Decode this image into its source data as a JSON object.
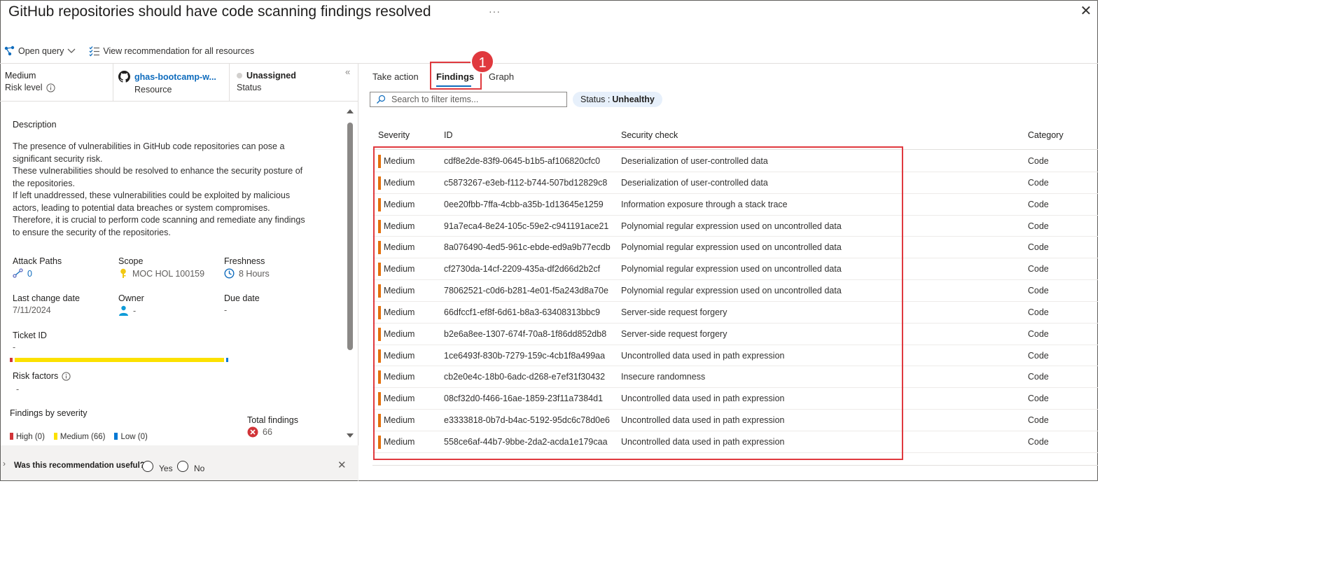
{
  "header": {
    "title": "GitHub repositories should have code scanning findings resolved",
    "more_label": "···",
    "close_label": "✕"
  },
  "toolbar": {
    "open_query_label": "Open query",
    "view_all_label": "View recommendation for all resources"
  },
  "meta": {
    "risk_level_value": "Medium",
    "risk_level_label": "Risk level",
    "resource_value": "ghas-bootcamp-w...",
    "resource_label": "Resource",
    "status_value": "Unassigned",
    "status_label": "Status"
  },
  "details": {
    "description_title": "Description",
    "description_lines": [
      "The presence of vulnerabilities in GitHub code repositories can pose a",
      "significant security risk.",
      "These vulnerabilities should be resolved to enhance the security posture of",
      "the repositories.",
      "If left unaddressed, these vulnerabilities could be exploited by malicious",
      "actors, leading to potential data breaches or system compromises.",
      "Therefore, it is crucial to perform code scanning and remediate any findings",
      "to ensure the security of the repositories."
    ],
    "attack_paths_label": "Attack Paths",
    "attack_paths_value": "0",
    "scope_label": "Scope",
    "scope_value": "MOC HOL 100159",
    "freshness_label": "Freshness",
    "freshness_value": "8 Hours",
    "last_change_label": "Last change date",
    "last_change_value": "7/11/2024",
    "owner_label": "Owner",
    "owner_value": "-",
    "due_date_label": "Due date",
    "due_date_value": "-",
    "ticket_label": "Ticket ID",
    "ticket_value": "-",
    "risk_factors_label": "Risk factors",
    "risk_factors_value": "-",
    "findings_by_severity_label": "Findings by severity",
    "severity_counts": {
      "high": 0,
      "medium": 66,
      "low": 0
    },
    "legend_high": "High (0)",
    "legend_medium": "Medium (66)",
    "legend_low": "Low (0)",
    "total_findings_label": "Total findings",
    "total_findings_value": "66"
  },
  "feedback": {
    "question": "Was this recommendation useful?",
    "yes": "Yes",
    "no": "No"
  },
  "tabs": [
    "Take action",
    "Findings",
    "Graph"
  ],
  "active_tab": "Findings",
  "annotation_number": "1",
  "filter": {
    "placeholder": "Search to filter items...",
    "status_key": "Status :",
    "status_value": "Unhealthy"
  },
  "table": {
    "columns": [
      "Severity",
      "ID",
      "Security check",
      "Category"
    ],
    "rows": [
      [
        "Medium",
        "cdf8e2de-83f9-0645-b1b5-af106820cfc0",
        "Deserialization of user-controlled data",
        "Code"
      ],
      [
        "Medium",
        "c5873267-e3eb-f112-b744-507bd12829c8",
        "Deserialization of user-controlled data",
        "Code"
      ],
      [
        "Medium",
        "0ee20fbb-7ffa-4cbb-a35b-1d13645e1259",
        "Information exposure through a stack trace",
        "Code"
      ],
      [
        "Medium",
        "91a7eca4-8e24-105c-59e2-c941191ace21",
        "Polynomial regular expression used on uncontrolled data",
        "Code"
      ],
      [
        "Medium",
        "8a076490-4ed5-961c-ebde-ed9a9b77ecdb",
        "Polynomial regular expression used on uncontrolled data",
        "Code"
      ],
      [
        "Medium",
        "cf2730da-14cf-2209-435a-df2d66d2b2cf",
        "Polynomial regular expression used on uncontrolled data",
        "Code"
      ],
      [
        "Medium",
        "78062521-c0d6-b281-4e01-f5a243d8a70e",
        "Polynomial regular expression used on uncontrolled data",
        "Code"
      ],
      [
        "Medium",
        "66dfccf1-ef8f-6d61-b8a3-63408313bbc9",
        "Server-side request forgery",
        "Code"
      ],
      [
        "Medium",
        "b2e6a8ee-1307-674f-70a8-1f86dd852db8",
        "Server-side request forgery",
        "Code"
      ],
      [
        "Medium",
        "1ce6493f-830b-7279-159c-4cb1f8a499aa",
        "Uncontrolled data used in path expression",
        "Code"
      ],
      [
        "Medium",
        "cb2e0e4c-18b0-6adc-d268-e7ef31f30432",
        "Insecure randomness",
        "Code"
      ],
      [
        "Medium",
        "08cf32d0-f466-16ae-1859-23f11a7384d1",
        "Uncontrolled data used in path expression",
        "Code"
      ],
      [
        "Medium",
        "e3333818-0b7d-b4ac-5192-95dc6c78d0e6",
        "Uncontrolled data used in path expression",
        "Code"
      ],
      [
        "Medium",
        "558ce6af-44b7-9bbe-2da2-acda1e179caa",
        "Uncontrolled data used in path expression",
        "Code"
      ]
    ]
  },
  "colors": {
    "accent": "#0f6cbd",
    "severity_medium": "#e3700d",
    "severity_high": "#d13438",
    "severity_low": "#0078d4",
    "medium_bar": "#fce100",
    "highlight": "#e0393e"
  },
  "icons": {
    "open_query": "query-graph-icon",
    "view_all": "list-check-icon",
    "resource": "github-icon",
    "attack_paths": "attack-path-icon",
    "scope": "key-icon",
    "freshness": "clock-icon",
    "owner": "person-icon",
    "total_findings": "error-circle-icon",
    "search": "search-icon"
  }
}
